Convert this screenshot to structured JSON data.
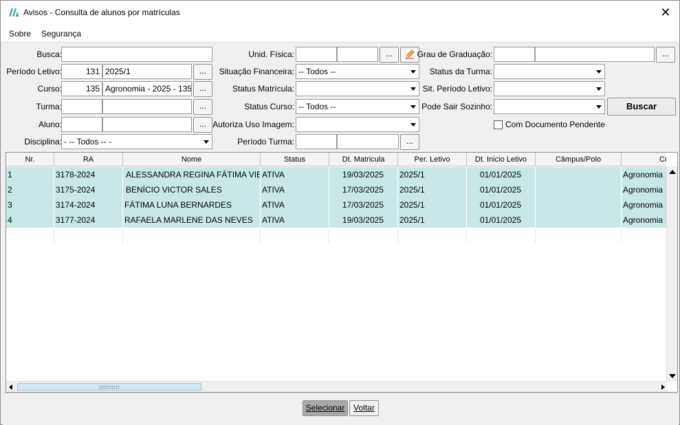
{
  "window": {
    "title": "Avisos - Consulta de alunos por matrículas",
    "close_label": "✕"
  },
  "menu": {
    "items": [
      "Sobre",
      "Segurança"
    ]
  },
  "form": {
    "busca": {
      "label": "Busca:",
      "value": ""
    },
    "periodo_letivo": {
      "label": "Período Letivo:",
      "code": "131",
      "value": "2025/1"
    },
    "curso": {
      "label": "Curso:",
      "code": "135",
      "value": "Agronomia - 2025 - 135"
    },
    "turma": {
      "label": "Turma:",
      "code": "",
      "value": ""
    },
    "aluno": {
      "label": "Aluno:",
      "code": "",
      "value": ""
    },
    "disciplina": {
      "label": "Disciplina:",
      "value": "- -- Todos -- -"
    },
    "unid_fisica": {
      "label": "Unid. Física:",
      "code": "",
      "value": ""
    },
    "situacao_financeira": {
      "label": "Situação Financeira:",
      "value": "-- Todos --"
    },
    "status_matricula": {
      "label": "Status Matrícula:",
      "value": ""
    },
    "status_curso": {
      "label": "Status Curso:",
      "value": "-- Todos --"
    },
    "autoriza_uso_imagem": {
      "label": "Autoriza Uso Imagem:",
      "value": ""
    },
    "periodo_turma": {
      "label": "Período Turma:",
      "code": "",
      "value": ""
    },
    "grau_graduacao": {
      "label": "Grau de Graduação:",
      "code": "",
      "value": ""
    },
    "status_turma": {
      "label": "Status da Turma:",
      "value": ""
    },
    "sit_periodo_letivo": {
      "label": "Sit. Período Letivo:",
      "value": ""
    },
    "pode_sair_sozinho": {
      "label": "Pode Sair Sozinho:",
      "value": ""
    },
    "com_documento_pendente": {
      "label": "Com Documento Pendente",
      "checked": false
    },
    "dots_label": "...",
    "buscar_label": "Buscar"
  },
  "grid": {
    "columns": [
      "Nr.",
      "RA",
      "Nome",
      "Status",
      "Dt. Matricula",
      "Per. Letivo",
      "Dt. Inicio Letivo",
      "Câmpus/Polo",
      "Cu"
    ],
    "rows": [
      {
        "nr": "1",
        "ra": "3178-2024",
        "nome": "ALESSANDRA REGINA FÁTIMA VIEI...",
        "status": "ATIVA",
        "dt_matricula": "19/03/2025",
        "per_letivo": "2025/1",
        "dt_inicio": "01/01/2025",
        "campus": "",
        "curso": "Agronomia"
      },
      {
        "nr": "2",
        "ra": "3175-2024",
        "nome": "BENÍCIO VICTOR SALES",
        "status": "ATIVA",
        "dt_matricula": "17/03/2025",
        "per_letivo": "2025/1",
        "dt_inicio": "01/01/2025",
        "campus": "",
        "curso": "Agronomia"
      },
      {
        "nr": "3",
        "ra": "3174-2024",
        "nome": "FÁTIMA LUNA BERNARDES",
        "status": "ATIVA",
        "dt_matricula": "17/03/2025",
        "per_letivo": "2025/1",
        "dt_inicio": "01/01/2025",
        "campus": "",
        "curso": "Agronomia"
      },
      {
        "nr": "4",
        "ra": "3177-2024",
        "nome": "RAFAELA MARLENE DAS NEVES",
        "status": "ATIVA",
        "dt_matricula": "19/03/2025",
        "per_letivo": "2025/1",
        "dt_inicio": "01/01/2025",
        "campus": "",
        "curso": "Agronomia"
      }
    ],
    "row_color": "#c8e8e8"
  },
  "footer": {
    "selecionar_label": "Selecionar",
    "voltar_label": "Voltar"
  },
  "colors": {
    "accent_logo": "#1a9a8a",
    "selected_button": "#a9a9a9"
  }
}
